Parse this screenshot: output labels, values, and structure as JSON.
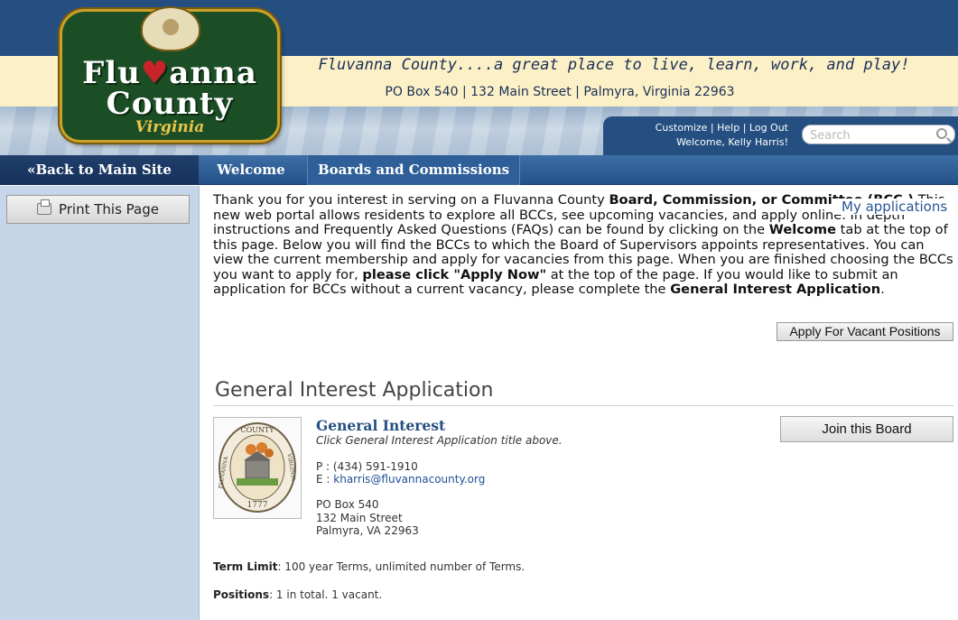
{
  "header": {
    "logo_line1_a": "Flu",
    "logo_heart": "♥",
    "logo_line1_b": "anna",
    "logo_line2": "County",
    "logo_line3": "Virginia",
    "tagline": "Fluvanna County....a great place to live, learn, work, and play!",
    "address": "PO Box 540 | 132 Main Street | Palmyra, Virginia 22963",
    "user_links": {
      "customize": "Customize",
      "help": "Help",
      "logout": "Log Out",
      "separator": " | "
    },
    "welcome": "Welcome, Kelly Harris!",
    "search_placeholder": "Search"
  },
  "nav": {
    "back": "«Back to Main Site",
    "tabs": [
      {
        "label": "Welcome"
      },
      {
        "label": "Boards and Commissions"
      }
    ]
  },
  "sidebar": {
    "print_label": "Print This Page"
  },
  "main": {
    "my_applications": "My applications",
    "intro": {
      "p1": "Thank you for you interest in serving on a Fluvanna County ",
      "b1": "Board, Commission, or Committee (BCC.)",
      "p2": " This new web portal allows residents to explore all BCCs, see upcoming vacancies, and apply online. In depth instructions and Frequently Asked Questions (FAQs) can be found by clicking on the ",
      "b2": "Welcome",
      "p3": " tab at the top of this page. Below you will find the BCCs to which the Board of Supervisors appoints representatives. You can view the current membership and apply for vacancies from this page. When you are finished choosing the BCCs you want to apply for, ",
      "b3": "please click \"Apply Now\"",
      "p4": " at the top of the page. If you would like to submit an application for BCCs without a current vacancy, please complete the ",
      "b4": "General Interest Application",
      "p5": "."
    },
    "apply_button": "Apply For Vacant Positions",
    "section_title": "General Interest Application",
    "board": {
      "title": "General Interest",
      "subtitle": "Click General Interest Application title above.",
      "phone": "P : (434) 591-1910",
      "email_prefix": "E : ",
      "email": "kharris@fluvannacounty.org",
      "address_line1": "PO Box 540",
      "address_line2": "132 Main Street",
      "address_line3": "Palmyra, VA 22963",
      "join_button": "Join this Board",
      "seal_top_text": "COUNTY",
      "seal_year": "1777",
      "seal_left_text": "FLUVANNA",
      "seal_right_text": "VIRGINIA"
    },
    "term_limit_label": "Term Limit",
    "term_limit_value": ": 100 year Terms, unlimited number of Terms.",
    "positions_label": "Positions",
    "positions_value": ": 1 in total. 1 vacant."
  },
  "colors": {
    "header_blue": "#244f80",
    "tagline_cream": "#fbf0c6",
    "sidebar_blue": "#c6d6e9",
    "link_blue": "#2a5596",
    "logo_green": "#1c4e26"
  }
}
